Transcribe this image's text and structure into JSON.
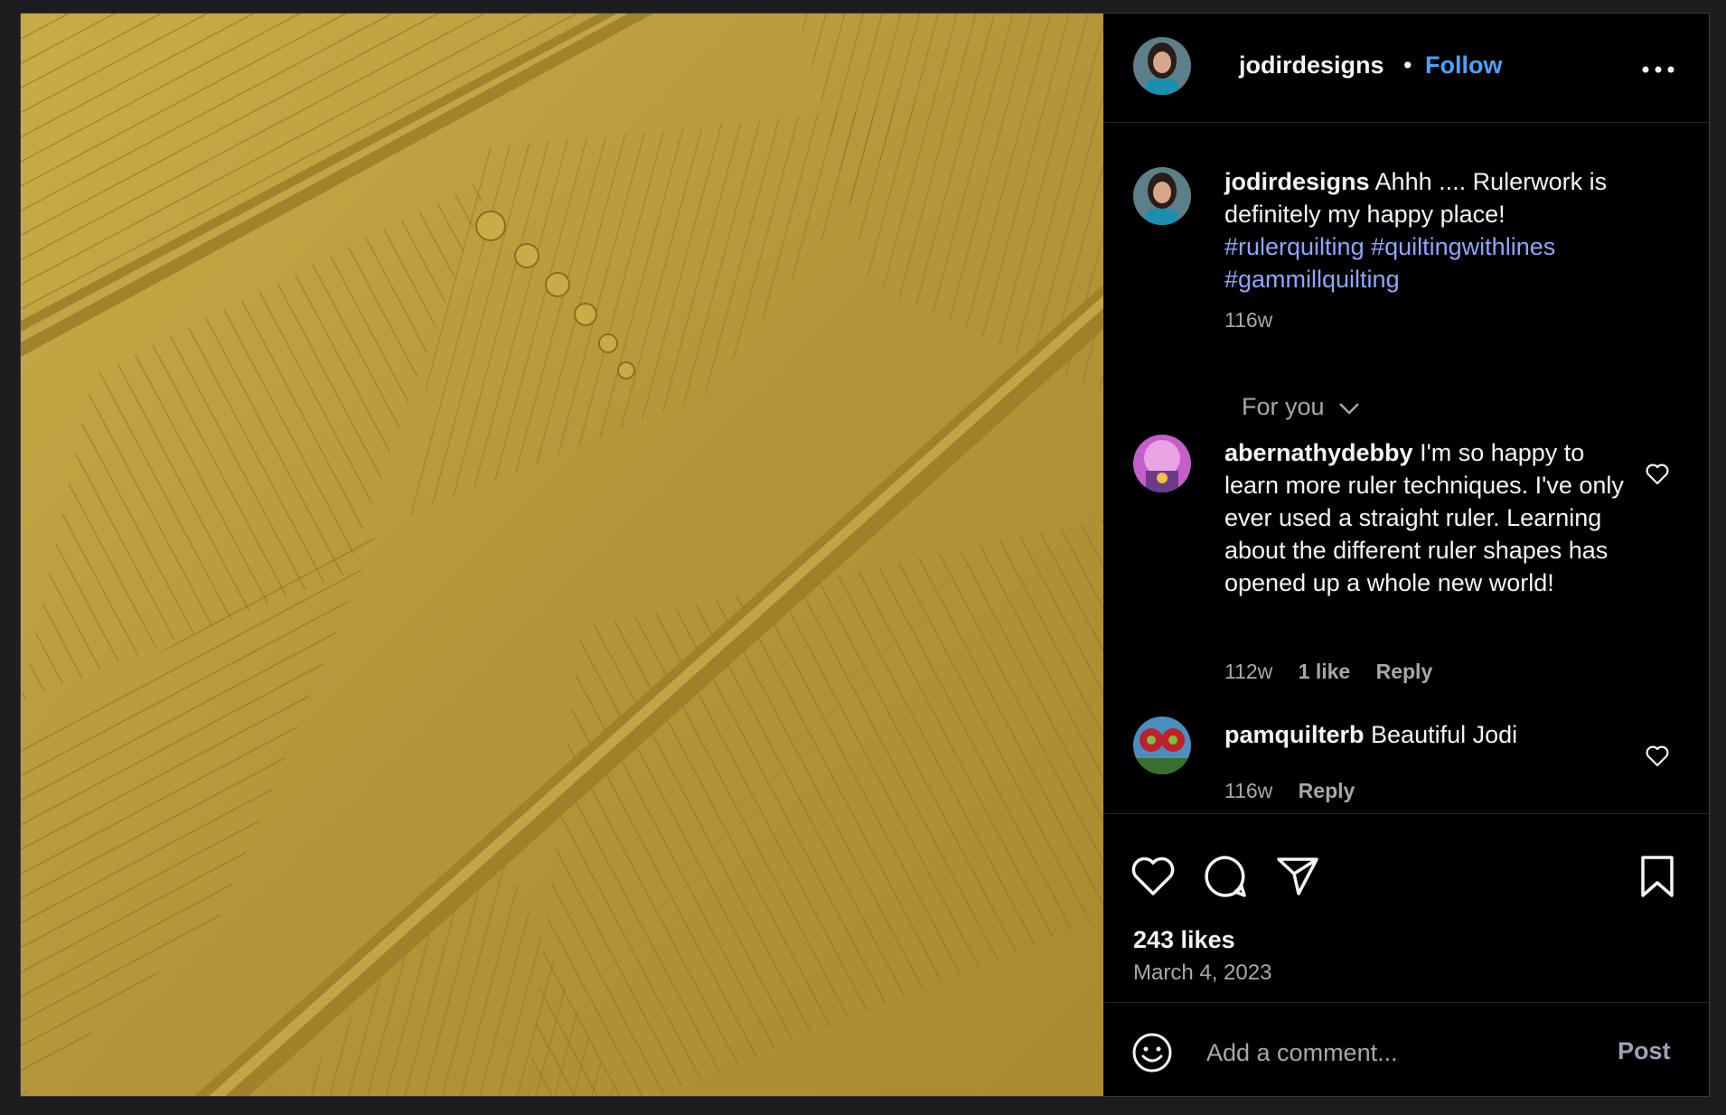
{
  "post": {
    "author": "jodirdesigns",
    "separator": "•",
    "follow_label": "Follow",
    "caption_text": "Ahhh .... Rulerwork is definitely my happy place!",
    "hashtags": [
      "#rulerquilting",
      "#quiltingwithlines",
      "#gammillquilting"
    ],
    "caption_time": "116w",
    "sort_label": "For you",
    "likes_text": "243 likes",
    "date_text": "March 4, 2023"
  },
  "comments": [
    {
      "user": "abernathydebby",
      "text": "I'm so happy to learn more ruler techniques. I've only ever used a straight ruler. Learning about the different ruler shapes has opened up a whole new world!",
      "time": "112w",
      "likes": "1 like",
      "reply": "Reply"
    },
    {
      "user": "pamquilterb",
      "text": "Beautiful Jodi",
      "time": "116w",
      "reply": "Reply"
    }
  ],
  "comment_box": {
    "placeholder": "Add a comment...",
    "post_label": "Post"
  },
  "icons": {
    "more": "more-options-icon",
    "like": "heart-icon",
    "comment": "comment-bubble-icon",
    "share": "paper-plane-icon",
    "save": "bookmark-icon",
    "emoji": "emoji-icon",
    "chevron": "chevron-down-icon"
  },
  "colors": {
    "background": "#000000",
    "text": "#f5f5f5",
    "secondary": "#a8a8a8",
    "link": "#4aa3ff",
    "hashtag": "#8ea6ff",
    "fabric": "#b89a3a"
  }
}
